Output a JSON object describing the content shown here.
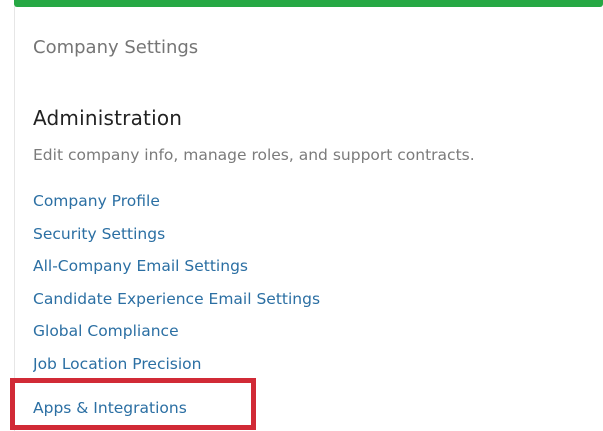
{
  "panel": {
    "title": "Company Settings",
    "accent_color": "#27a844"
  },
  "administration": {
    "heading": "Administration",
    "description": "Edit company info, manage roles, and support contracts.",
    "links": [
      {
        "label": "Company Profile"
      },
      {
        "label": "Security Settings"
      },
      {
        "label": "All-Company Email Settings"
      },
      {
        "label": "Candidate Experience Email Settings"
      },
      {
        "label": "Global Compliance"
      },
      {
        "label": "Job Location Precision"
      }
    ],
    "highlighted_link": {
      "label": "Apps & Integrations",
      "highlight_color": "#d12a36"
    }
  },
  "colors": {
    "link": "#2b6fa3",
    "heading": "#222222",
    "muted": "#7b7b7b"
  }
}
